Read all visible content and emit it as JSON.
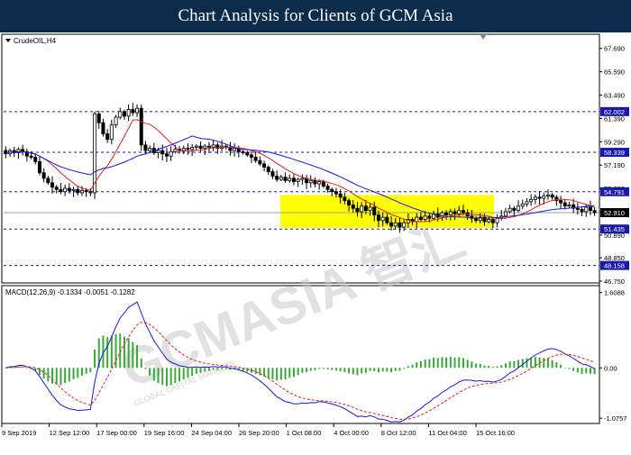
{
  "page": {
    "banner_title": "Chart Analysis for Clients of GCM Asia",
    "watermark": "GCMASIA 智汇",
    "watermark_sub": "GLOBAL CAPITAL MARKETS"
  },
  "chart_data": [
    {
      "type": "candlestick",
      "symbol_label": "CrudeOIL,H4",
      "ylim": [
        46.75,
        68.8
      ],
      "price_ticks": [
        "67.690",
        "65.590",
        "63.490",
        "61.390",
        "59.290",
        "57.190",
        "55.090",
        "52.990",
        "50.890",
        "48.850",
        "46.750"
      ],
      "levels": [
        {
          "value": 62.002,
          "label": "62.002",
          "style": "dashed",
          "color": "#1a1aa8",
          "badge": "#1a1aa8"
        },
        {
          "value": 58.339,
          "label": "58.339",
          "style": "dashed",
          "color": "#1a1aa8",
          "badge": "#1a1aa8"
        },
        {
          "value": 54.791,
          "label": "54.791",
          "style": "dashed",
          "color": "#1a1aa8",
          "badge": "#1a1aa8"
        },
        {
          "value": 52.91,
          "label": "52.910",
          "style": "solid",
          "color": "#9aa0a6",
          "badge": "#000000"
        },
        {
          "value": 51.435,
          "label": "51.435",
          "style": "dashed",
          "color": "#1a1aa8",
          "badge": "#1a1aa8"
        },
        {
          "value": 48.158,
          "label": "48.158",
          "style": "dashed",
          "color": "#1a1aa8",
          "badge": "#1a1aa8"
        }
      ],
      "highlight_zone": {
        "x_start": 311,
        "x_end": 548,
        "y_top": 54.5,
        "y_bottom": 51.55,
        "color": "#ffff00"
      },
      "x_labels": [
        "9 Sep 2019",
        "12 Sep 12:00",
        "17 Sep 00:00",
        "19 Sep 16:00",
        "24 Sep 04:00",
        "26 Sep 20:00",
        "1 Oct 08:00",
        "4 Oct 00:00",
        "8 Oct 12:00",
        "11 Oct 04:00",
        "15 Oct 16:00"
      ],
      "closes": [
        58.2,
        58.5,
        58.3,
        58.6,
        58.4,
        58.0,
        57.9,
        57.5,
        56.5,
        56.0,
        55.6,
        55.2,
        55.0,
        54.8,
        55.1,
        54.9,
        55.0,
        54.7,
        54.9,
        54.8,
        54.7,
        61.8,
        61.0,
        60.0,
        59.5,
        60.8,
        61.5,
        62.0,
        61.6,
        62.2,
        61.9,
        62.3,
        59.0,
        58.5,
        58.7,
        58.3,
        58.5,
        58.2,
        58.0,
        58.4,
        58.6,
        58.5,
        58.7,
        58.6,
        58.8,
        58.9,
        58.7,
        58.9,
        58.8,
        59.0,
        58.7,
        58.9,
        58.8,
        58.5,
        58.7,
        58.4,
        58.3,
        58.1,
        57.9,
        57.6,
        57.3,
        57.0,
        56.6,
        56.2,
        55.9,
        56.1,
        55.8,
        56.0,
        55.7,
        55.9,
        56.0,
        55.6,
        55.8,
        55.5,
        55.7,
        55.3,
        55.0,
        54.8,
        54.6,
        54.3,
        54.0,
        53.6,
        53.3,
        53.0,
        53.5,
        53.1,
        53.4,
        52.7,
        52.2,
        52.5,
        52.0,
        51.7,
        52.0,
        51.6,
        52.0,
        52.3,
        52.1,
        52.5,
        52.3,
        52.6,
        52.4,
        52.8,
        52.5,
        52.9,
        52.7,
        53.0,
        52.8,
        53.1,
        52.9,
        52.6,
        52.4,
        52.2,
        52.5,
        52.1,
        52.3,
        52.0,
        52.4,
        52.6,
        53.0,
        53.3,
        53.1,
        53.5,
        53.7,
        53.9,
        54.1,
        54.3,
        54.2,
        54.4,
        54.5,
        54.3,
        54.0,
        53.8,
        53.5,
        53.6,
        53.3,
        53.2,
        53.0,
        53.4,
        53.1,
        52.9
      ],
      "macd_label": "MACD(12,26,9) -0.1334 -0.0051 -0.1282",
      "macd_ticks": [
        "1.6088",
        "0.00",
        "-1.0757"
      ],
      "macd_ylim": [
        -1.15,
        1.7
      ],
      "ma_colors": {
        "fast": "#e02020",
        "slow": "#1a1ad8"
      },
      "macd_colors": {
        "line": "#1a1ad8",
        "signal": "#e02020",
        "histogram": "#3aa83a"
      }
    }
  ]
}
